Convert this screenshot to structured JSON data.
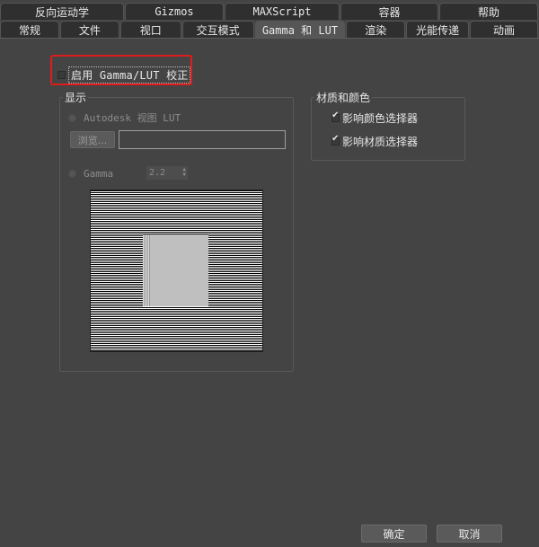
{
  "tabs_row1": [
    "反向运动学",
    "Gizmos",
    "MAXScript",
    "容器",
    "帮助"
  ],
  "tabs_row2": [
    "常规",
    "文件",
    "视口",
    "交互模式",
    "Gamma 和 LUT",
    "渲染",
    "光能传递",
    "动画"
  ],
  "active_tab": "Gamma 和 LUT",
  "enable_label": "启用 Gamma/LUT 校正",
  "enable_checked": false,
  "display_group": {
    "title": "显示",
    "lut_label": "Autodesk 视图 LUT",
    "browse_label": "浏览...",
    "lut_path": "",
    "gamma_label": "Gamma",
    "gamma_value": "2.2"
  },
  "material_group": {
    "title": "材质和颜色",
    "affect_color_label": "影响颜色选择器",
    "affect_color_checked": true,
    "affect_material_label": "影响材质选择器",
    "affect_material_checked": true
  },
  "footer": {
    "ok_label": "确定",
    "cancel_label": "取消"
  },
  "colors": {
    "background": "#444444",
    "highlight": "#e01b1b",
    "tab_bg": "#2f2f2f",
    "tab_active_bg": "#565656"
  }
}
